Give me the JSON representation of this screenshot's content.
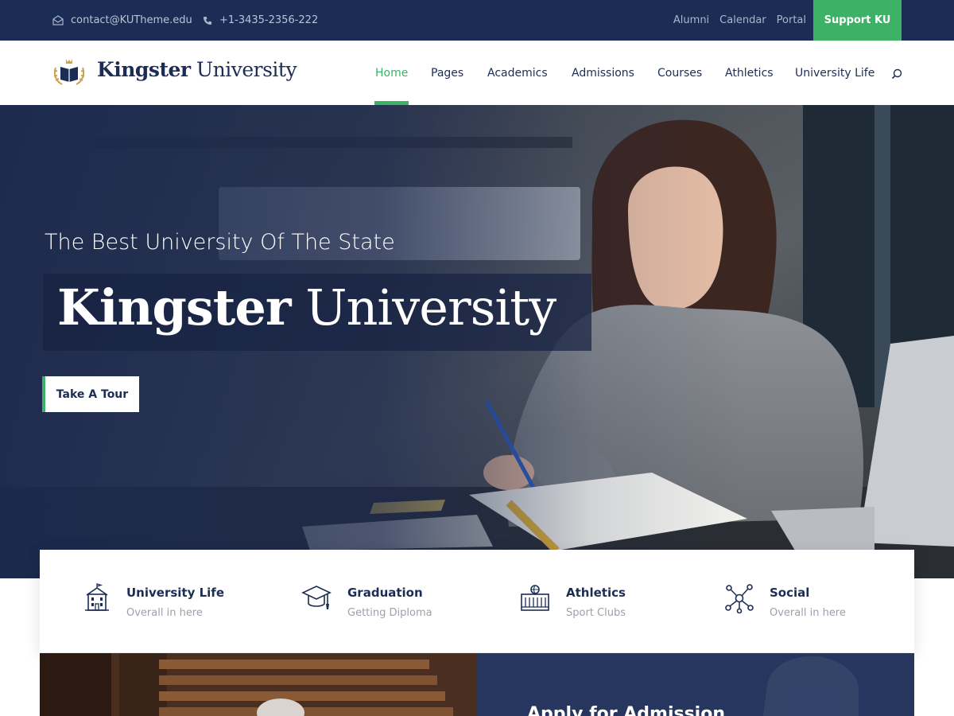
{
  "topbar": {
    "email": "contact@KUTheme.edu",
    "phone": "+1-3435-2356-222",
    "links": [
      "Alumni",
      "Calendar",
      "Portal"
    ],
    "support_label": "Support KU"
  },
  "header": {
    "logo_bold": "Kingster",
    "logo_regular": "University",
    "nav": [
      "Home",
      "Pages",
      "Academics",
      "Admissions",
      "Courses",
      "Athletics",
      "University Life"
    ],
    "active_nav": "Home"
  },
  "hero": {
    "subtitle": "The Best University Of The State",
    "title_bold": "Kingster",
    "title_regular": "University",
    "cta_label": "Take A Tour"
  },
  "features": [
    {
      "title": "University Life",
      "subtitle": "Overall in here",
      "icon": "building-icon"
    },
    {
      "title": "Graduation",
      "subtitle": "Getting Diploma",
      "icon": "graduation-cap-icon"
    },
    {
      "title": "Athletics",
      "subtitle": "Sport Clubs",
      "icon": "stadium-icon"
    },
    {
      "title": "Social",
      "subtitle": "Overall in here",
      "icon": "network-icon"
    }
  ],
  "apply": {
    "title": "Apply for Admission"
  },
  "colors": {
    "navy": "#1c2d55",
    "accent_green": "#3db166",
    "muted_text": "#9aa1ad"
  }
}
